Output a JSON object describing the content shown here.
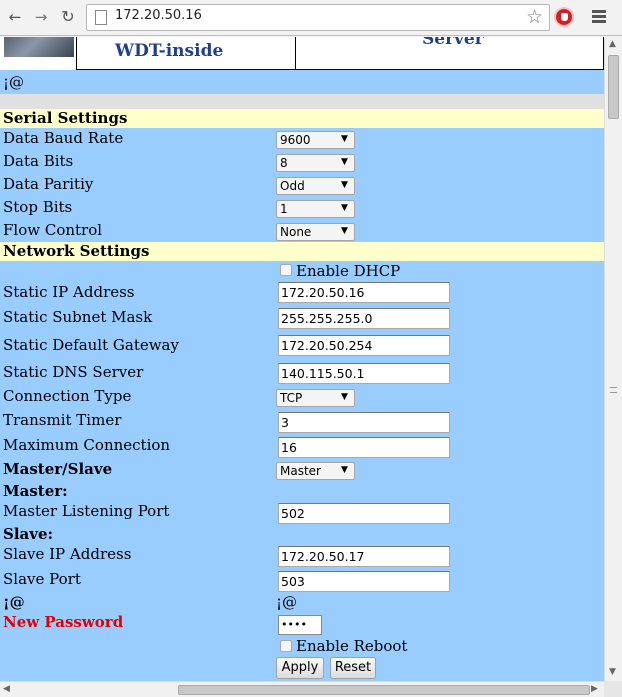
{
  "browser": {
    "url": "172.20.50.16"
  },
  "header": {
    "product_title": "WDT-inside",
    "server_title": "Server"
  },
  "note_text": "¡@",
  "serial": {
    "section_title": "Serial Settings",
    "fields": [
      {
        "label": "Data Baud Rate",
        "value": "9600"
      },
      {
        "label": "Data Bits",
        "value": "8"
      },
      {
        "label": "Data Paritiy",
        "value": "Odd"
      },
      {
        "label": "Stop Bits",
        "value": "1"
      },
      {
        "label": "Flow Control",
        "value": "None"
      }
    ]
  },
  "network": {
    "section_title": "Network Settings",
    "dhcp_label": "Enable DHCP",
    "dhcp_checked": false,
    "static_ip_label": "Static IP Address",
    "static_ip": "172.20.50.16",
    "subnet_label": "Static Subnet Mask",
    "subnet": "255.255.255.0",
    "gateway_label": "Static Default Gateway",
    "gateway": "172.20.50.254",
    "dns_label": "Static DNS Server",
    "dns": "140.115.50.1",
    "conn_type_label": "Connection Type",
    "conn_type": "TCP",
    "transmit_label": "Transmit Timer",
    "transmit": "3",
    "maxconn_label": "Maximum Connection",
    "maxconn": "16",
    "master_slave_label": "Master/Slave",
    "master_slave": "Master",
    "master_heading": "Master:",
    "master_port_label": "Master Listening Port",
    "master_port": "502",
    "slave_heading": "Slave:",
    "slave_ip_label": "Slave IP Address",
    "slave_ip": "172.20.50.17",
    "slave_port_label": "Slave Port",
    "slave_port": "503",
    "filler_left": "¡@",
    "filler_right": "¡@",
    "password_label": "New Password",
    "password_mask": "••••",
    "reboot_label": "Enable Reboot",
    "reboot_checked": false,
    "apply_label": "Apply",
    "reset_label": "Reset"
  },
  "colors": {
    "form_bg": "#99ccff",
    "section_bg": "#ffffcc",
    "title_color": "#1f3f8a",
    "password_label_color": "#e00000"
  }
}
